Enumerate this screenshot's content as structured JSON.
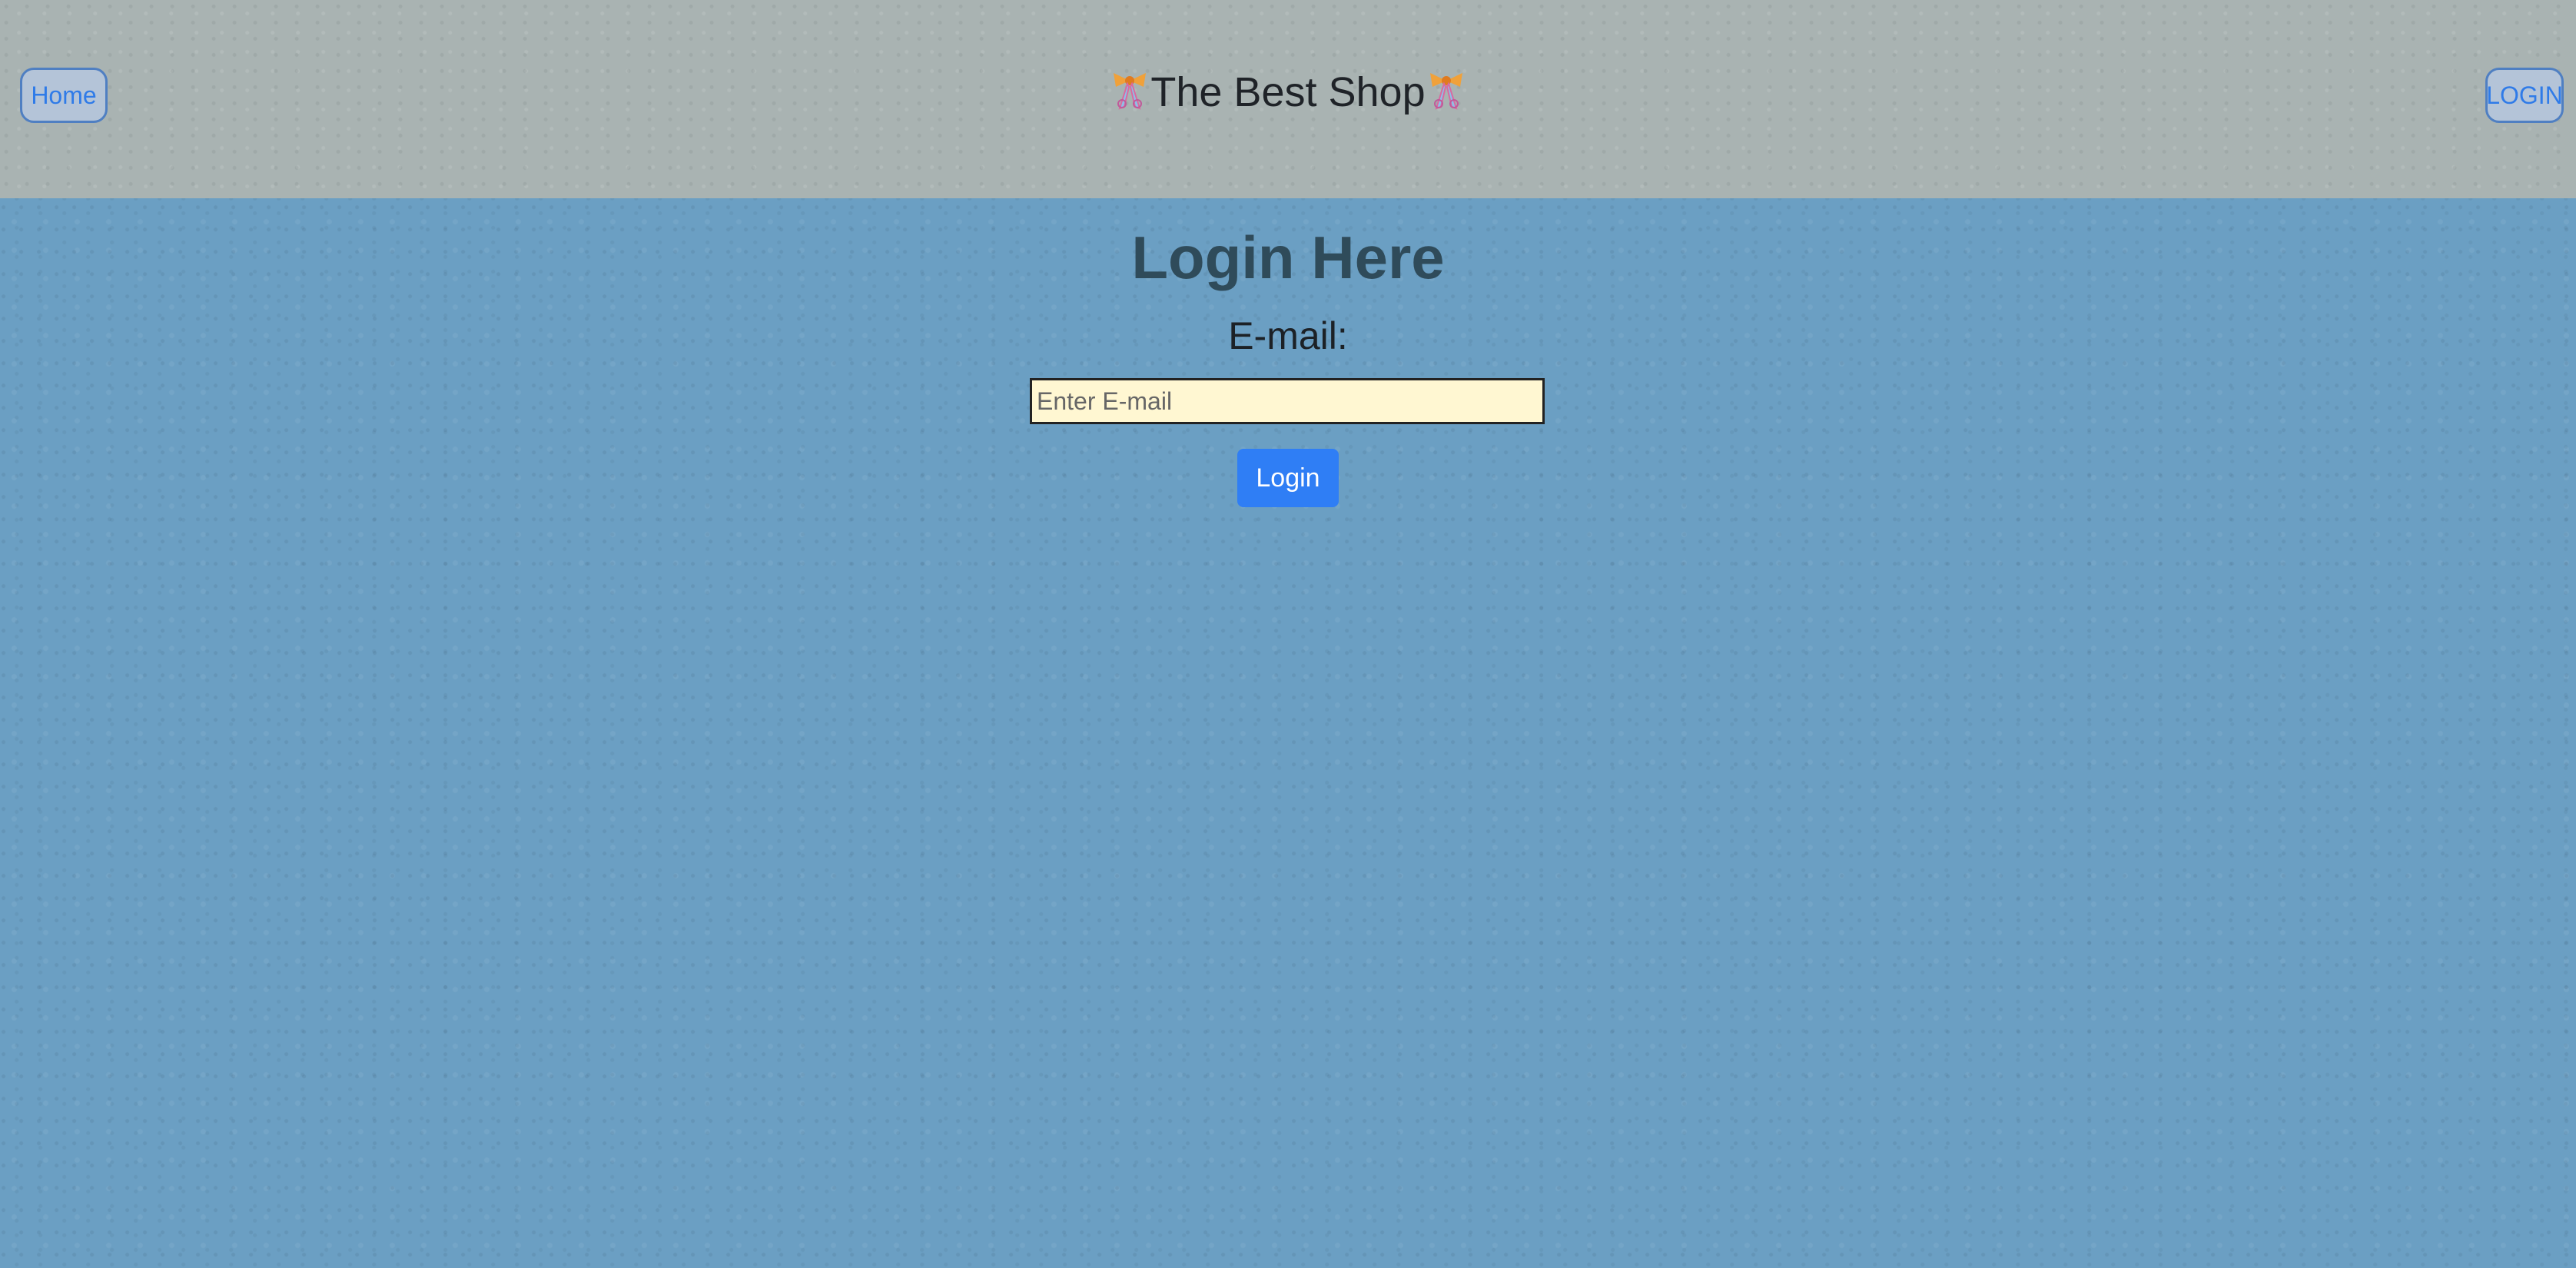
{
  "header": {
    "home_label": "Home",
    "brand_title": "The Best Shop",
    "login_label": "LOGIN"
  },
  "main": {
    "title": "Login Here",
    "email_label": "E-mail:",
    "email_placeholder": "Enter E-mail",
    "email_value": "",
    "submit_label": "Login"
  },
  "icons": {
    "brand_left": "ribbon-bow-icon",
    "brand_right": "ribbon-bow-icon"
  },
  "colors": {
    "header_bg": "#a9b3b2",
    "page_bg": "#6b9fc3",
    "accent": "#2f7ef5",
    "input_bg": "#fff7d2"
  }
}
